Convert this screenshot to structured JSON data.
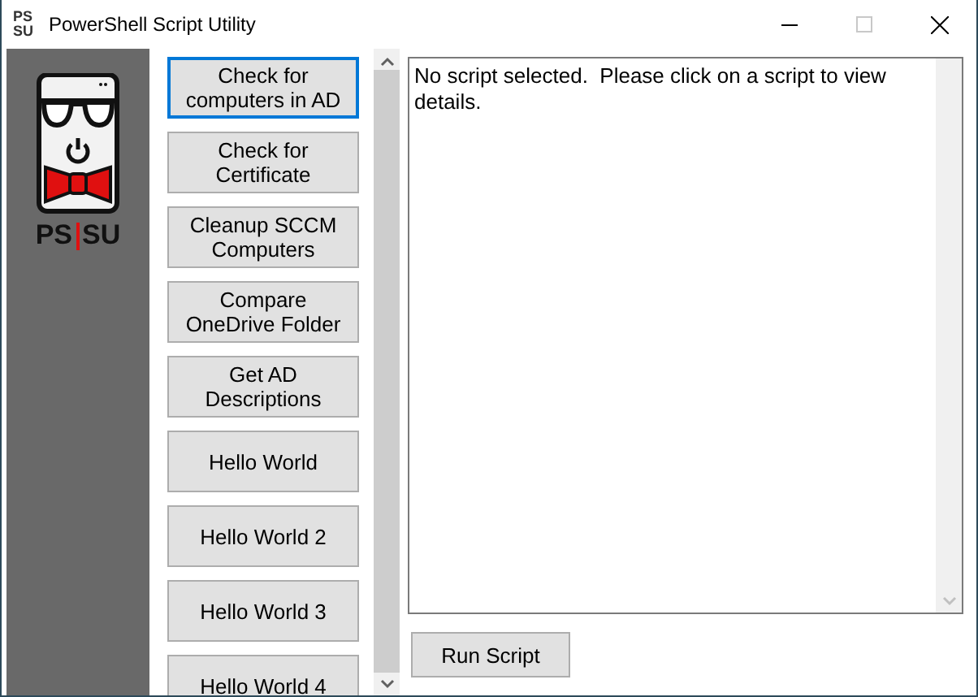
{
  "window": {
    "title": "PowerShell Script Utility",
    "icon_text": [
      "PS",
      "SU"
    ],
    "controls": [
      {
        "kind": "minimize",
        "disabled": false
      },
      {
        "kind": "maximize",
        "disabled": true
      },
      {
        "kind": "close",
        "disabled": false
      }
    ]
  },
  "logo": {
    "left": "PS",
    "right": "SU"
  },
  "scripts": [
    {
      "label": "Check for computers in AD",
      "selected": true
    },
    {
      "label": "Check for Certificate",
      "selected": false
    },
    {
      "label": "Cleanup SCCM Computers",
      "selected": false
    },
    {
      "label": "Compare OneDrive Folder",
      "selected": false
    },
    {
      "label": "Get AD Descriptions",
      "selected": false
    },
    {
      "label": "Hello World",
      "selected": false
    },
    {
      "label": "Hello World 2",
      "selected": false
    },
    {
      "label": "Hello World 3",
      "selected": false
    },
    {
      "label": "Hello World 4",
      "selected": false
    }
  ],
  "details": {
    "value": "No script selected.  Please click on a script to view details."
  },
  "run_button": "Run Script"
}
